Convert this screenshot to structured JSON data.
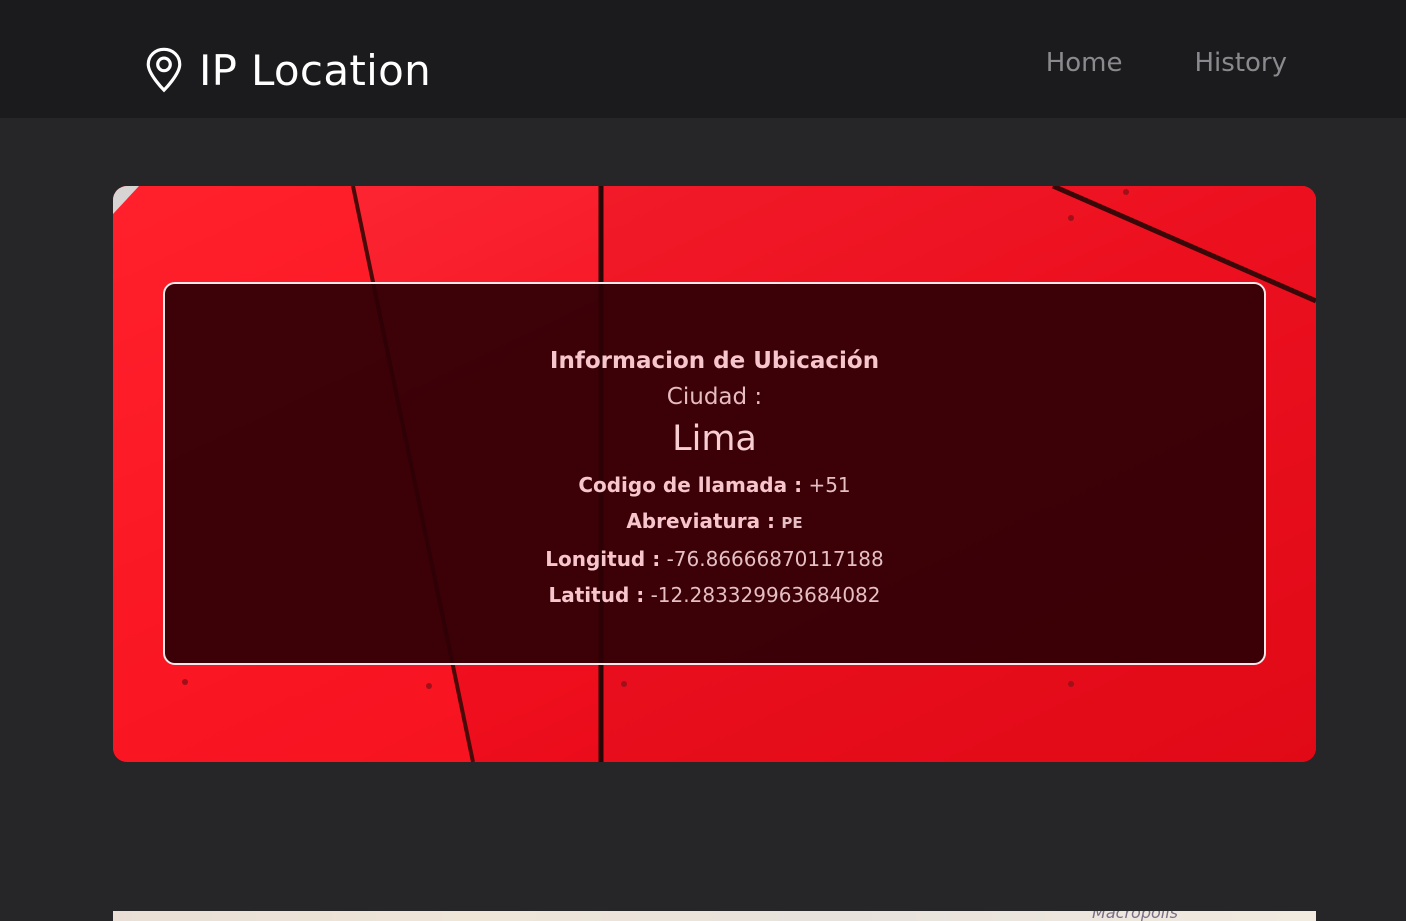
{
  "app": {
    "brand_name": "IP Location",
    "brand_icon": "map-pin-icon"
  },
  "nav": {
    "home_label": "Home",
    "history_label": "History"
  },
  "location": {
    "title": "Informacion de Ubicación",
    "city_label": "Ciudad :",
    "city_value": "Lima",
    "calling_code_label": "Codigo de llamada :",
    "calling_code_value": "+51",
    "abbreviation_label": "Abreviatura :",
    "abbreviation_value": "PE",
    "longitude_label": "Longitud :",
    "longitude_value": "-76.86666870117188",
    "latitude_label": "Latitud :",
    "latitude_value": "-12.283329963684082"
  },
  "map": {
    "partial_label": "Macropolis"
  },
  "colors": {
    "navbar_bg": "#1b1b1d",
    "page_bg": "#262628",
    "hero_red": "#ff1e2c",
    "overlay_text": "#f6c6cc"
  }
}
